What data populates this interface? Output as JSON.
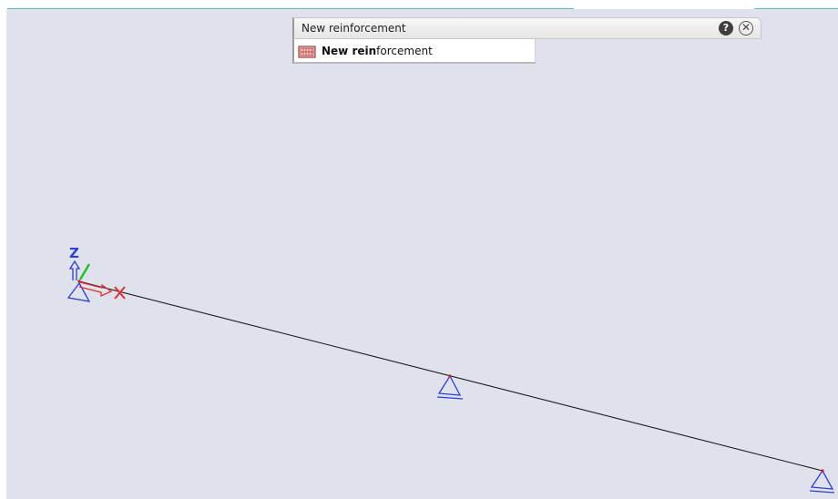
{
  "panel": {
    "title": "New reinforcement",
    "help_icon": "question-circle-icon",
    "close_icon": "close-circle-icon",
    "help_glyph": "?",
    "close_glyph": "✕"
  },
  "items": [
    {
      "label_bold": "New rein",
      "label_rest": "forcement",
      "icon": "reinforcement-icon"
    }
  ],
  "axes": {
    "z_label": "Z"
  },
  "colors": {
    "accent": "#4fc7b8",
    "viewport_bg": "#dfe2ec",
    "beam": "#1a1a1a",
    "support": "#2a3fd6",
    "x_axis": "#e03030",
    "y_axis": "#22c022",
    "z_axis": "#2a3fd6",
    "node": "#d01818"
  }
}
